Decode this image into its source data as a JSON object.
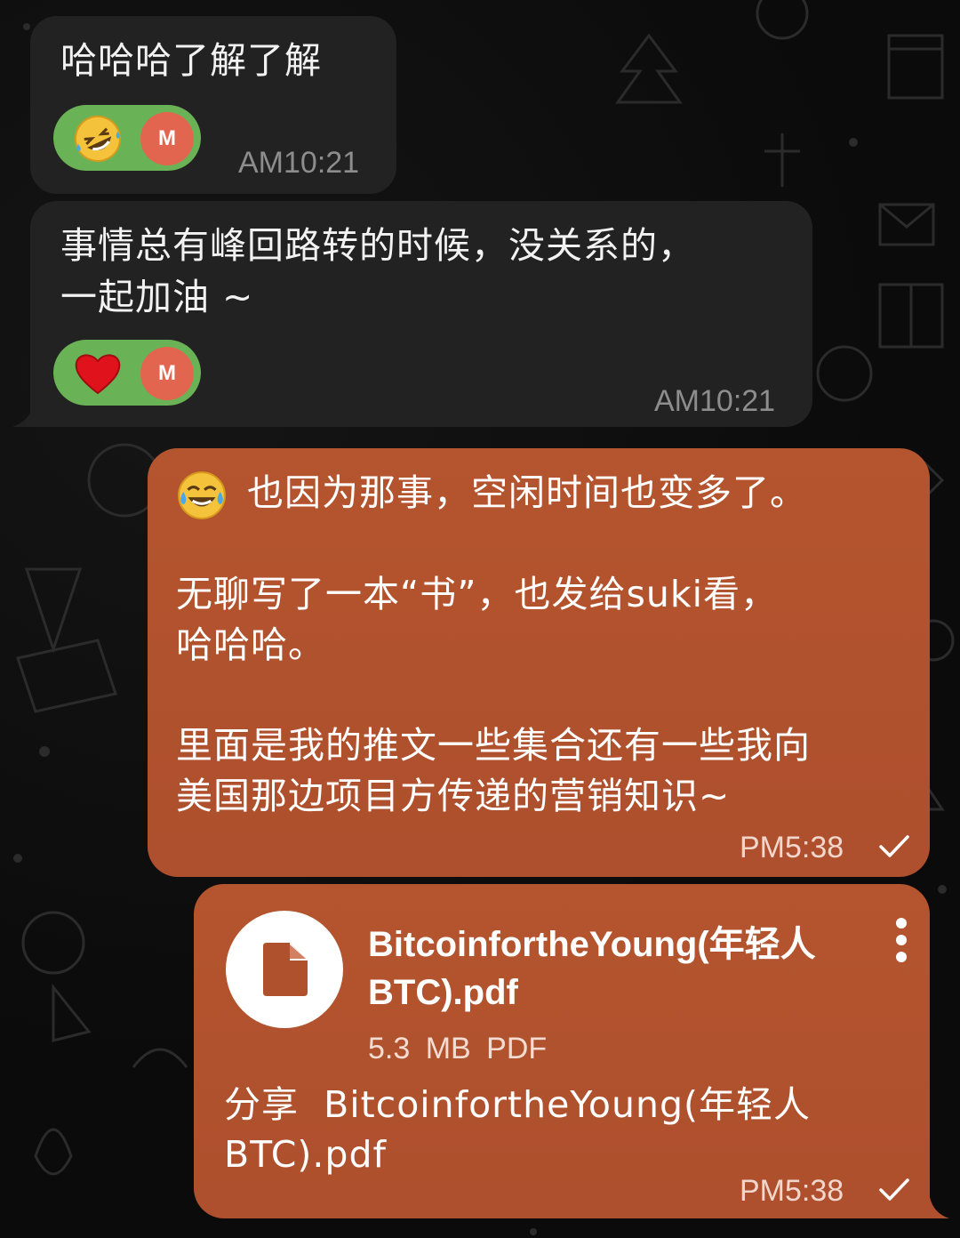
{
  "messages": [
    {
      "direction": "incoming",
      "text": "哈哈哈了解了解",
      "reaction": {
        "emoji": "rolling-on-floor-laughing",
        "user_initial": "M"
      },
      "time": "AM10:21"
    },
    {
      "direction": "incoming",
      "text_line1": "事情总有峰回路转的时候，没关系的，",
      "text_line2": "一起加油 ~",
      "reaction": {
        "emoji": "red-heart",
        "user_initial": "M"
      },
      "time": "AM10:21"
    },
    {
      "direction": "outgoing",
      "line1": "也因为那事，空闲时间也变多了。",
      "line2": "无聊写了一本“书”，也发给suki看，",
      "line3": "哈哈哈。",
      "line4": "里面是我的推文一些集合还有一些我向",
      "line5": "美国那边项目方传递的营销知识~",
      "leading_emoji": "face-with-tears-of-joy",
      "time": "PM5:38",
      "status": "sent-check"
    },
    {
      "direction": "outgoing",
      "type": "file",
      "file_name_line1": "BitcoinfortheYoung(年轻人",
      "file_name_line2": "BTC).pdf",
      "file_meta": "5.3 MB PDF",
      "caption_line1": "分享  BitcoinfortheYoung(年轻人",
      "caption_line2": "BTC).pdf",
      "time": "PM5:38",
      "status": "sent-check"
    }
  ],
  "colors": {
    "background": "#0b0b0b",
    "incoming_bubble": "#222222",
    "outgoing_bubble": "#b0512e",
    "reaction_pill": "#69b255",
    "avatar": "#e2664f"
  }
}
